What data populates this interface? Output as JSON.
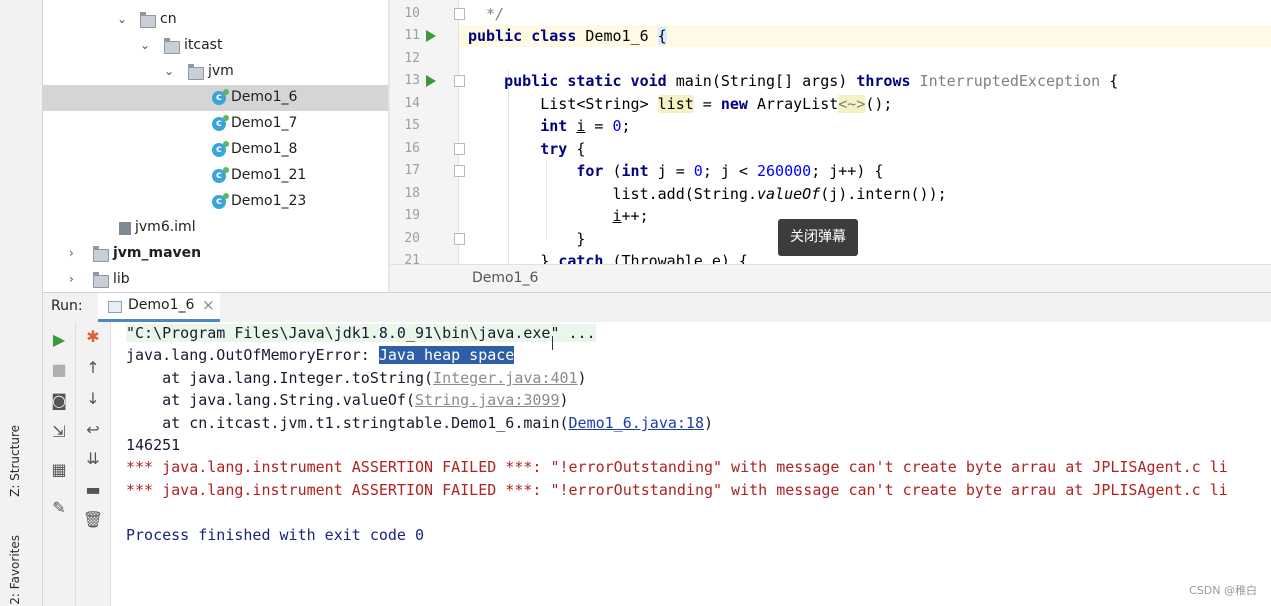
{
  "side_tabs": {
    "structure": "Z: Structure",
    "favorites": "2: Favorites"
  },
  "project_tree": [
    {
      "label": "cn",
      "bold": false
    },
    {
      "label": "itcast",
      "bold": false
    },
    {
      "label": "jvm",
      "bold": false
    },
    {
      "label": "Demo1_6",
      "bold": false,
      "selected": true
    },
    {
      "label": "Demo1_7",
      "bold": false
    },
    {
      "label": "Demo1_8",
      "bold": false
    },
    {
      "label": "Demo1_21",
      "bold": false
    },
    {
      "label": "Demo1_23",
      "bold": false
    },
    {
      "label": "jvm6.iml",
      "bold": false
    },
    {
      "label": "jvm_maven",
      "bold": true
    },
    {
      "label": "lib",
      "bold": false
    }
  ],
  "editor": {
    "line_numbers": [
      "10",
      "11",
      "12",
      "13",
      "14",
      "15",
      "16",
      "17",
      "18",
      "19",
      "20",
      "21"
    ],
    "tab_label": "Demo1_6"
  },
  "tooltip": "关闭弹幕",
  "run_panel": {
    "label": "Run:",
    "tab": "Demo1_6",
    "close": "×"
  },
  "console": {
    "command": "\"C:\\Program Files\\Java\\jdk1.8.0_91\\bin\\java.exe\" ...",
    "error_prefix": "java.lang.OutOfMemoryError: ",
    "error_selected": "Java heap space",
    "stack": [
      {
        "prefix": "    at java.lang.Integer.toString(",
        "link": "Integer.java:401",
        "suffix": ")"
      },
      {
        "prefix": "    at java.lang.String.valueOf(",
        "link": "String.java:3099",
        "suffix": ")"
      },
      {
        "prefix": "    at cn.itcast.jvm.t1.stringtable.Demo1_6.main(",
        "link": "Demo1_6.java:18",
        "suffix": ")"
      }
    ],
    "count": "146251",
    "assertions": [
      "*** java.lang.instrument ASSERTION FAILED ***: \"!errorOutstanding\" with message can't create byte arrau at JPLISAgent.c li",
      "*** java.lang.instrument ASSERTION FAILED ***: \"!errorOutstanding\" with message can't create byte arrau at JPLISAgent.c li"
    ],
    "exit": "Process finished with exit code 0"
  },
  "watermark": "CSDN @稚白"
}
